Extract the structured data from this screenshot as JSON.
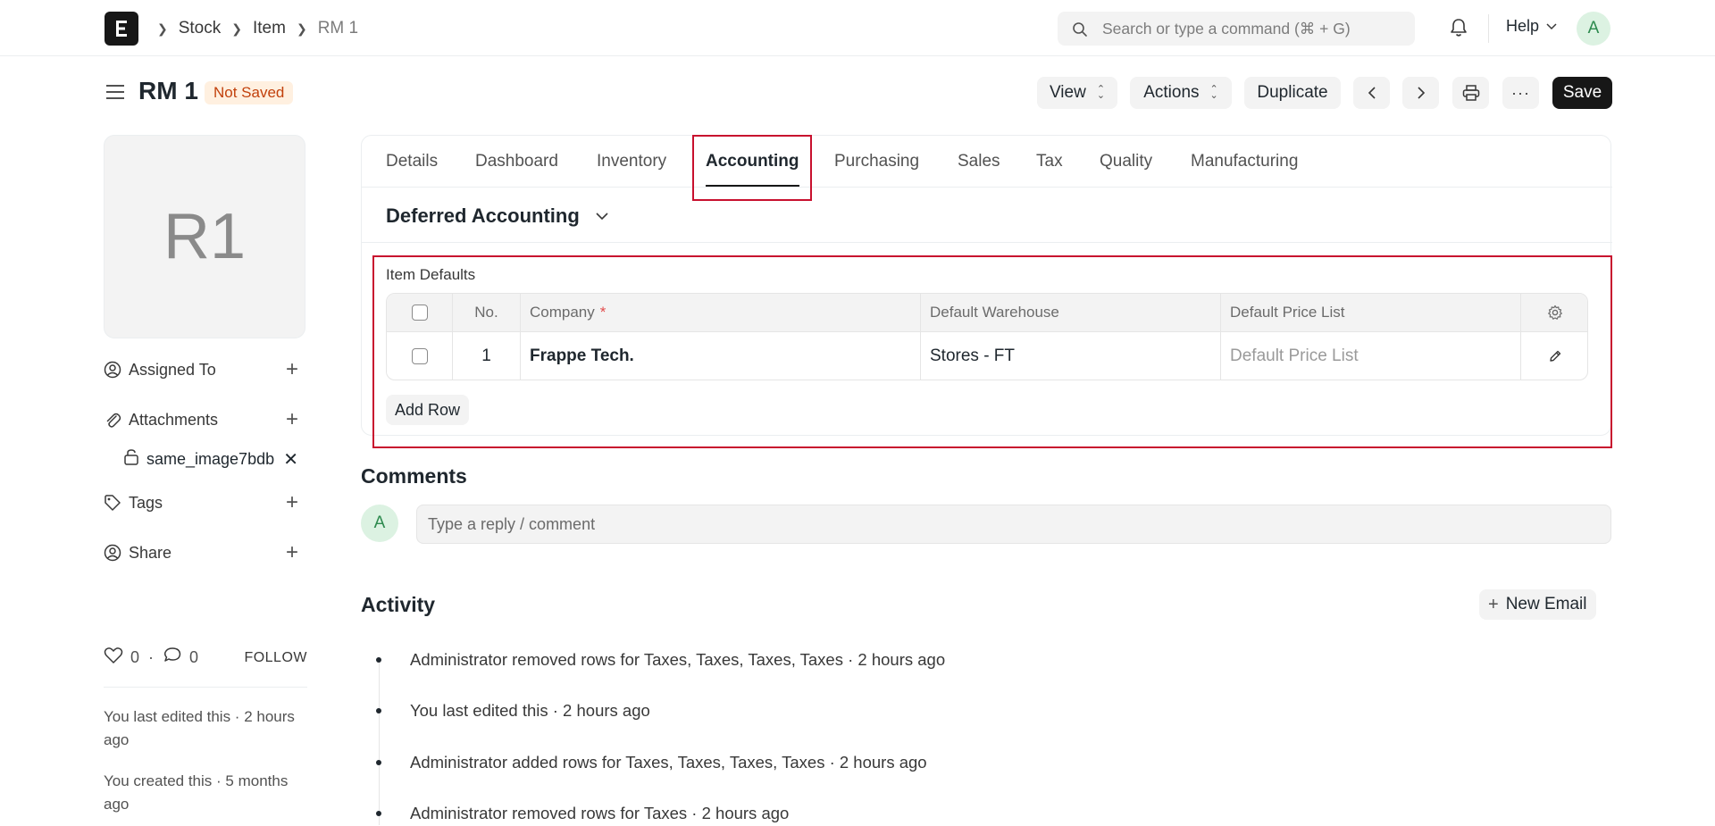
{
  "navbar": {
    "breadcrumbs": [
      "Stock",
      "Item",
      "RM 1"
    ],
    "search_placeholder": "Search or type a command (⌘ + G)",
    "help_label": "Help",
    "avatar_initial": "A"
  },
  "header": {
    "title": "RM 1",
    "status": "Not Saved",
    "view_label": "View",
    "actions_label": "Actions",
    "duplicate_label": "Duplicate",
    "save_label": "Save"
  },
  "sidebar": {
    "image_initials": "R1",
    "assigned_to": "Assigned To",
    "attachments": "Attachments",
    "attachment_file": "same_image7bdb",
    "tags": "Tags",
    "share": "Share",
    "likes": "0",
    "comments_count": "0",
    "follow": "FOLLOW",
    "last_edited": "You last edited this · 2 hours ago",
    "created": "You created this · 5 months ago"
  },
  "tabs": [
    "Details",
    "Dashboard",
    "Inventory",
    "Accounting",
    "Purchasing",
    "Sales",
    "Tax",
    "Quality",
    "Manufacturing"
  ],
  "active_tab": "Accounting",
  "section": {
    "title": "Deferred Accounting"
  },
  "item_defaults": {
    "label": "Item Defaults",
    "columns": {
      "no": "No.",
      "company": "Company",
      "required_mark": "*",
      "warehouse": "Default Warehouse",
      "price_list": "Default Price List"
    },
    "rows": [
      {
        "no": "1",
        "company": "Frappe Tech.",
        "warehouse": "Stores - FT",
        "price_list_placeholder": "Default Price List"
      }
    ],
    "add_row": "Add Row"
  },
  "comments": {
    "title": "Comments",
    "avatar_initial": "A",
    "placeholder": "Type a reply / comment"
  },
  "activity": {
    "title": "Activity",
    "new_email": "New Email",
    "items": [
      "Administrator removed rows for Taxes, Taxes, Taxes, Taxes · 2 hours ago",
      "You last edited this · 2 hours ago",
      "Administrator added rows for Taxes, Taxes, Taxes, Taxes · 2 hours ago",
      "Administrator removed rows for Taxes · 2 hours ago"
    ]
  },
  "colors": {
    "highlight": "#c8102e",
    "primary_button": "#171717",
    "status_badge_bg": "#fff0e0",
    "status_badge_text": "#c2410c"
  },
  "icons": [
    "app-logo-icon",
    "search-icon",
    "bell-icon",
    "chevron-down-icon",
    "hamburger-icon",
    "chevron-left-icon",
    "chevron-right-icon",
    "printer-icon",
    "more-icon",
    "assign-icon",
    "paperclip-icon",
    "lock-icon",
    "tag-icon",
    "share-icon",
    "heart-icon",
    "comment-icon",
    "gear-icon",
    "edit-icon",
    "plus-icon",
    "close-icon"
  ]
}
